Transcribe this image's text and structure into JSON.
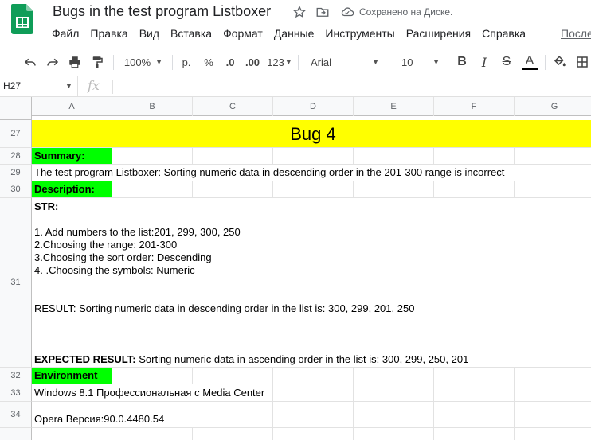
{
  "header": {
    "title": "Bugs in the test program Listboxer",
    "save_status": "Сохранено на Диске.",
    "menu": [
      "Файл",
      "Правка",
      "Вид",
      "Вставка",
      "Формат",
      "Данные",
      "Инструменты",
      "Расширения",
      "Справка"
    ],
    "last_edit": "После"
  },
  "toolbar": {
    "zoom": "100%",
    "currency": "р.",
    "percent": "%",
    "decrease_decimals": ".0",
    "increase_decimals": ".00",
    "number_format": "123",
    "font": "Arial",
    "font_size": "10",
    "bold": "B",
    "italic": "I",
    "strikethrough": "S",
    "text_color": "A"
  },
  "formula_bar": {
    "cell_ref": "H27",
    "fx": "fx"
  },
  "columns": [
    "A",
    "B",
    "C",
    "D",
    "E",
    "F",
    "G"
  ],
  "rows": {
    "r27": {
      "num": "27",
      "text": "Bug 4"
    },
    "r28": {
      "num": "28",
      "text": "Summary:"
    },
    "r29": {
      "num": "29",
      "text": "The test program Listboxer: Sorting numeric data in descending order in the 201-300 range is incorrect"
    },
    "r30": {
      "num": "30",
      "text": "Description:"
    },
    "r31": {
      "num": "31",
      "str_label": "STR:",
      "step1": "1. Add numbers to the list:201, 299, 300, 250",
      "step2": "2.Choosing the range: 201-300",
      "step3": "3.Choosing the sort order: Descending",
      "step4": "4. .Choosing the symbols: Numeric",
      "result": "RESULT: Sorting numeric data in descending order in the list  is: 300, 299, 201, 250",
      "expected_label": "EXPECTED RESULT:",
      "expected_text": " Sorting numeric data in ascending order in the list  is: 300, 299, 250, 201"
    },
    "r32": {
      "num": "32",
      "text": "Environment"
    },
    "r33": {
      "num": "33",
      "text": "Windows 8.1 Профессиональная с  Media Center"
    },
    "r34": {
      "num": "34",
      "text": "Opera  Версия:90.0.4480.54"
    }
  },
  "colors": {
    "highlight_yellow": "#ffff00",
    "highlight_green": "#00ff00",
    "sheets_green": "#0f9d58"
  }
}
